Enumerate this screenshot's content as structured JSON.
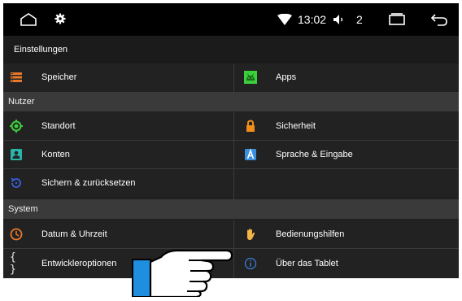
{
  "status": {
    "time": "13:02",
    "volume_level": "2",
    "icons": [
      "home-icon",
      "settings-gear-icon",
      "wifi-icon",
      "volume-icon",
      "recent-apps-icon",
      "back-icon"
    ]
  },
  "title": "Einstellungen",
  "items": {
    "speicher": "Speicher",
    "apps": "Apps",
    "standort": "Standort",
    "sicherheit": "Sicherheit",
    "konten": "Konten",
    "sprache": "Sprache & Eingabe",
    "sichern": "Sichern & zurücksetzen",
    "datum": "Datum & Uhrzeit",
    "bedienung": "Bedienungshilfen",
    "entwickler": "Entwickleroptionen",
    "ueber": "Über das Tablet"
  },
  "sections": {
    "nutzer": "Nutzer",
    "system": "System"
  },
  "colors": {
    "orange": "#e8792b",
    "green": "#3ccf3c",
    "teal": "#2ab3a8",
    "blue": "#3a7bd5",
    "lock": "#f28c1a",
    "hand_blue": "#1e8fe0"
  }
}
